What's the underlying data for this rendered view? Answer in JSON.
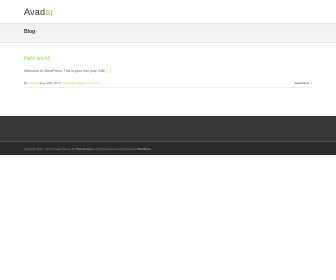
{
  "site": {
    "logo_text": "Avad",
    "logo_accent": "a"
  },
  "title_bar": {
    "title": "Blog"
  },
  "post": {
    "title": "Hello world!",
    "excerpt": "Welcome to WordPress. This is your first post. Edit",
    "excerpt_more": "[...]",
    "meta": {
      "author_prefix": "By",
      "author": "admin",
      "date": "June 13th, 2016",
      "category": "Uncategorized",
      "comments": "1 Comment"
    },
    "read_more": "Read More >"
  },
  "footer": {
    "copyright_prefix": "Copyright 2012 - 2016 | Avada Theme by",
    "copyright_link": "ThemeFusion",
    "copyright_suffix": "| All Rights Reserved | Powered by",
    "wordpress_link": "WordPress"
  },
  "colors": {
    "accent": "#a0ce4e",
    "footer_dark": "#363839",
    "footer_darker": "#282a2b"
  }
}
